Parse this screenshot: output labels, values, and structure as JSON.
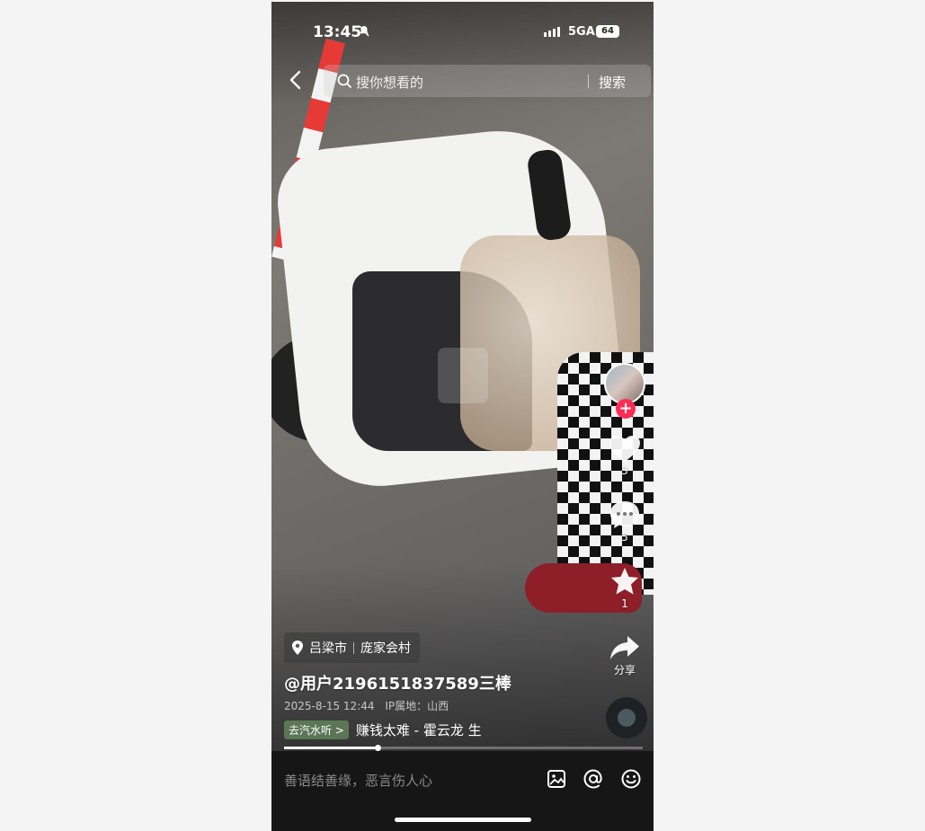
{
  "status_bar": {
    "time": "13:45",
    "network": "5GA",
    "battery": "64"
  },
  "search": {
    "placeholder": "搜你想看的",
    "button": "搜索"
  },
  "actions": {
    "like_count": "3",
    "comment_count": "5",
    "favorite_count": "1",
    "share_label": "分享"
  },
  "video_info": {
    "location_city": "吕梁市",
    "location_village": "庞家会村",
    "author": "@用户2196151837589三棒",
    "date": "2025-8-15 12:44",
    "ip_location": "IP属地：山西",
    "music_tag": "去汽水听 >",
    "music_title": "赚钱太难 - 霍云龙    生",
    "progress": 0.26
  },
  "comment_bar": {
    "placeholder": "善语结善缘，恶言伤人心"
  },
  "colors": {
    "accent": "#fe2c55",
    "background": "#161616"
  }
}
